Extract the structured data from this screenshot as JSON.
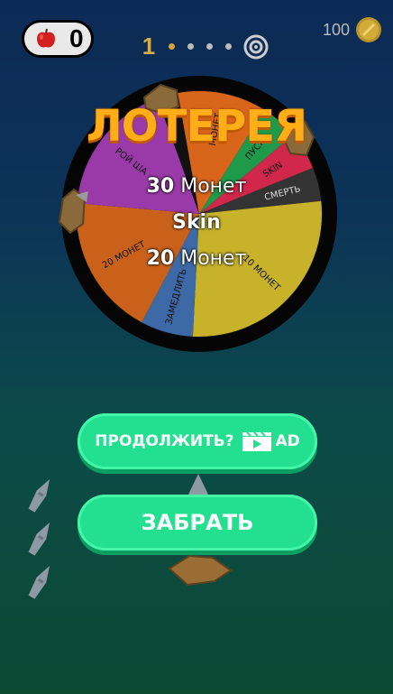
{
  "hud": {
    "apples": "0",
    "level": "1",
    "stage_dots": 4,
    "active_dot": 0,
    "coins": "100"
  },
  "wheel": {
    "title": "ЛОТЕРЕЯ",
    "segments": [
      {
        "label": "МОНЕТ",
        "color": "#d9651b"
      },
      {
        "label": "ПУСК",
        "color": "#1e9a4a"
      },
      {
        "label": "SKIN",
        "color": "#d0274a"
      },
      {
        "label": "СМЕРТЬ",
        "color": "#333333"
      },
      {
        "label": "10 МОНЕТ",
        "color": "#c7b22a"
      },
      {
        "label": "ЗАМЕДЛИТЬ",
        "color": "#3d6aa6"
      },
      {
        "label": "20 МОНЕТ",
        "color": "#c9611a"
      },
      {
        "label": "РОЙ ША",
        "color": "#9a3aa8"
      }
    ]
  },
  "rewards": [
    {
      "num": "30",
      "text": "Монет"
    },
    {
      "num": "",
      "text": "Skin"
    },
    {
      "num": "20",
      "text": "Монет"
    }
  ],
  "buttons": {
    "continue_label": "ПРОДОЛЖИТЬ?",
    "ad_label": "AD",
    "take_label": "ЗАБРАТЬ"
  },
  "knives_remaining": 3
}
